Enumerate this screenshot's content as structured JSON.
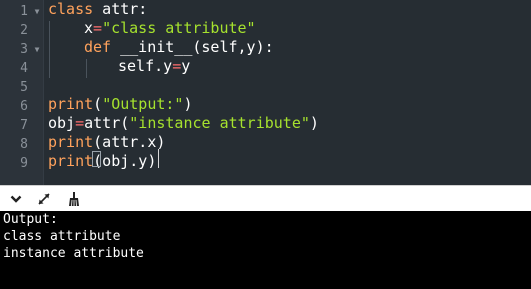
{
  "editor": {
    "line_numbers": [
      "1",
      "2",
      "3",
      "4",
      "5",
      "6",
      "7",
      "8",
      "9"
    ],
    "code": {
      "l1_kw": "class",
      "l1_rest": " attr:",
      "l2_x": "x",
      "l2_eq": "=",
      "l2_str": "\"class attribute\"",
      "l3_kw": "def",
      "l3_rest": " __init__(self,y):",
      "l4_a": "self.y",
      "l4_eq": "=",
      "l4_b": "y",
      "l6_kw": "print",
      "l6_p1": "(",
      "l6_str": "\"Output:\"",
      "l6_p2": ")",
      "l7_a": "obj",
      "l7_eq": "=",
      "l7_b": "attr(",
      "l7_str": "\"instance attribute\"",
      "l7_c": ")",
      "l8_kw": "print",
      "l8_rest": "(attr.x)",
      "l9_kw": "print",
      "l9_rest": "(obj.y)"
    },
    "colors": {
      "background": "#262d33",
      "keyword": "#ffa25c",
      "string": "#a6e22e",
      "operator": "#ff6e6e",
      "text": "#ffffff"
    }
  },
  "toolbar": {
    "collapse_icon": "chevron-down-icon",
    "expand_icon": "expand-arrows-icon",
    "clear_icon": "broom-icon"
  },
  "output": {
    "lines": [
      "Output:",
      "class attribute",
      "instance attribute"
    ],
    "colors": {
      "background": "#000000",
      "text": "#ffffff"
    }
  }
}
